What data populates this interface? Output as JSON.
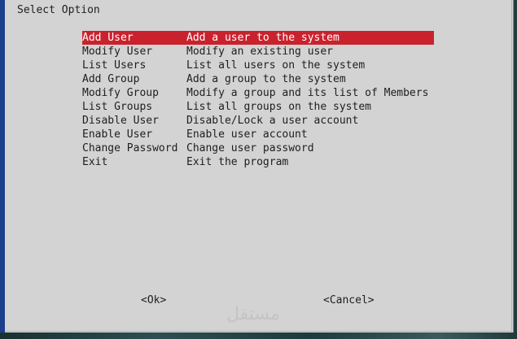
{
  "dialog": {
    "title": "Select Option"
  },
  "menu": {
    "selected_index": 0,
    "items": [
      {
        "tag": "Add User",
        "description": "Add a user to the system"
      },
      {
        "tag": "Modify User",
        "description": "Modify an existing user"
      },
      {
        "tag": "List Users",
        "description": "List all users on the system"
      },
      {
        "tag": "Add Group",
        "description": "Add a group to the system"
      },
      {
        "tag": "Modify Group",
        "description": "Modify a group and its list of Members"
      },
      {
        "tag": "List Groups",
        "description": "List all groups on the system"
      },
      {
        "tag": "Disable User",
        "description": "Disable/Lock a user account"
      },
      {
        "tag": "Enable User",
        "description": "Enable user account"
      },
      {
        "tag": "Change Password",
        "description": "Change user password"
      },
      {
        "tag": "Exit",
        "description": "Exit the program"
      }
    ]
  },
  "buttons": {
    "ok_label": "<Ok>",
    "cancel_label": "<Cancel>"
  },
  "watermark": {
    "text": "مستقل"
  },
  "colors": {
    "dialog_background": "#d3d3d3",
    "selection_background": "#c9222d",
    "selection_text": "#ffffff",
    "side_bar": "#1b3f8c"
  }
}
